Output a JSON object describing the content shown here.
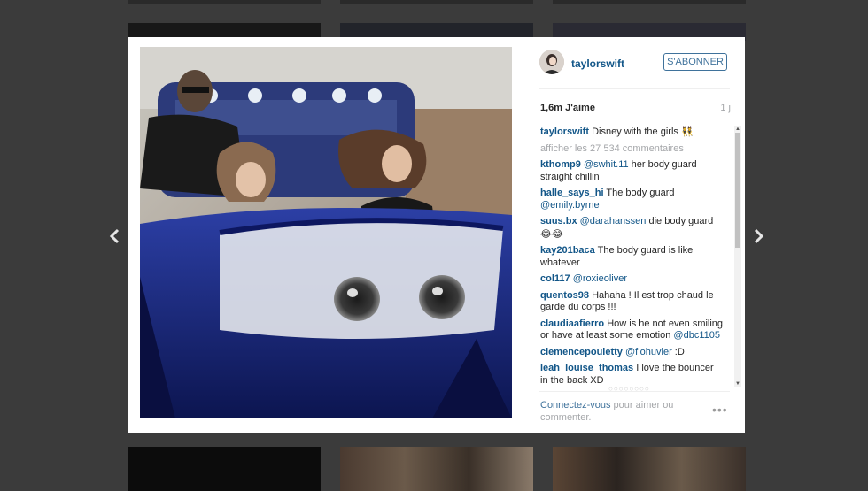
{
  "post": {
    "username": "taylorswift",
    "follow_label": "S'ABONNER",
    "likes": "1,6m J'aime",
    "time": "1 j",
    "caption_user": "taylorswift",
    "caption_text": "Disney with the girls",
    "caption_emoji": "👯",
    "load_more": "afficher les 27 534 commentaires",
    "image_description_icon": "photo"
  },
  "comments": [
    {
      "user": "kthomp9",
      "mention": "@swhit.11",
      "text": " her body guard straight chillin"
    },
    {
      "user": "halle_says_hi",
      "text": "The body guard ",
      "mention_after": "@emily.byrne"
    },
    {
      "user": "suus.bx",
      "mention": "@darahanssen",
      "text": " die body guard",
      "emoji": "😂😂"
    },
    {
      "user": "kay201baca",
      "text": "The body guard is like whatever"
    },
    {
      "user": "col117",
      "mention": "@roxieoliver"
    },
    {
      "user": "quentos98",
      "text": "Hahaha ! Il est trop chaud le garde du corps !!!"
    },
    {
      "user": "claudiaafierro",
      "text": "How is he not even smiling or have at least some emotion ",
      "mention_after": "@dbc1105"
    },
    {
      "user": "clemencepouletty",
      "mention": "@flohuvier",
      "text": " :D"
    },
    {
      "user": "leah_louise_thomas",
      "text": "I love the bouncer in the back XD"
    }
  ],
  "footer": {
    "login_link": "Connectez-vous",
    "login_text": " pour aimer ou commenter.",
    "more": "•••"
  },
  "nav": {
    "prev_icon": "chevron-left-icon",
    "next_icon": "chevron-right-icon"
  },
  "colors": {
    "link": "#125688",
    "button": "#3f729b",
    "muted": "#a5a7aa",
    "overlay": "#3b3b3b"
  }
}
